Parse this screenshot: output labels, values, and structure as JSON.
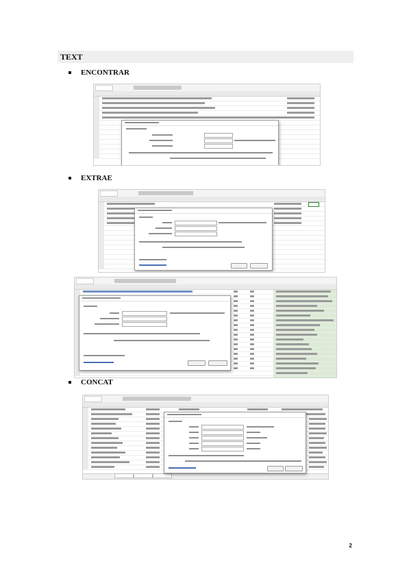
{
  "section": {
    "title": "TEXT"
  },
  "bullets": [
    {
      "label": "ENCONTRAR"
    },
    {
      "label": "EXTRAE"
    },
    {
      "label": "CONCAT"
    }
  ],
  "page_number": "2",
  "colors": {
    "section_bar": "#efefef",
    "grid_highlight": "#dcebd5",
    "link": "#4a6fb3"
  }
}
